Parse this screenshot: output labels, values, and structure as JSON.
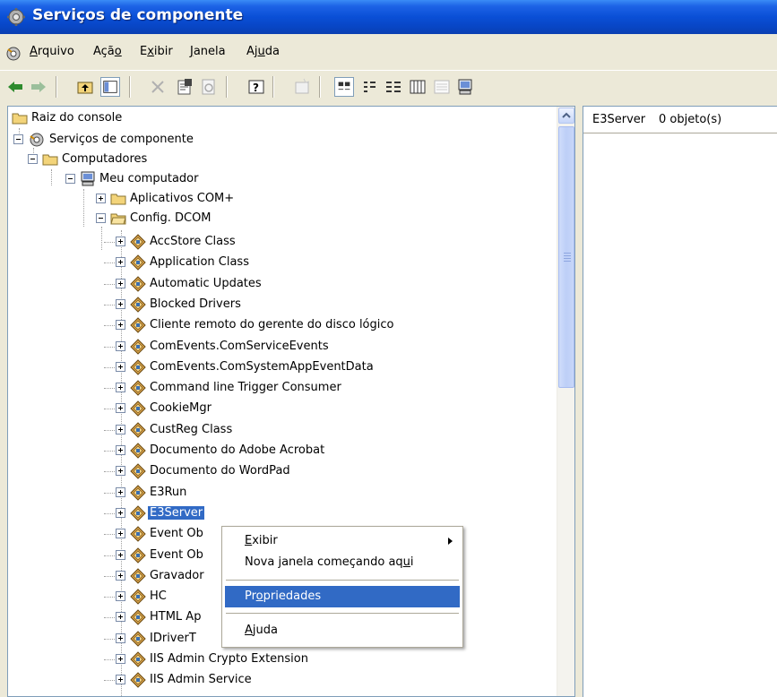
{
  "window": {
    "title": "Serviços de componente"
  },
  "menu": {
    "items": [
      {
        "pre": "",
        "mnem": "A",
        "post": "rquivo"
      },
      {
        "pre": "Açã",
        "mnem": "o",
        "post": ""
      },
      {
        "pre": "E",
        "mnem": "x",
        "post": "ibir"
      },
      {
        "pre": "",
        "mnem": "J",
        "post": "anela"
      },
      {
        "pre": "Aj",
        "mnem": "u",
        "post": "da"
      }
    ]
  },
  "toolbar": {
    "buttons": [
      "back-icon",
      "forward-icon",
      "up-folder-icon",
      "show-hide-tree-icon",
      "delete-icon",
      "properties-icon",
      "refresh-icon",
      "help-icon",
      "new-window-icon",
      "large-icons-icon",
      "small-icons-icon",
      "list-icon",
      "details-icon",
      "status-view-icon",
      "computer-icon"
    ]
  },
  "tree": {
    "root": "Raiz do console",
    "services": "Serviços de componente",
    "computers": "Computadores",
    "my_computer": "Meu computador",
    "com_apps": "Aplicativos COM+",
    "dcom": "Config. DCOM",
    "items": [
      "AccStore Class",
      "Application Class",
      "Automatic Updates",
      "Blocked Drivers",
      "Cliente remoto do gerente do disco lógico",
      "ComEvents.ComServiceEvents",
      "ComEvents.ComSystemAppEventData",
      "Command line Trigger Consumer",
      "CookieMgr",
      "CustReg Class",
      "Documento do Adobe Acrobat",
      "Documento do WordPad",
      "E3Run",
      "E3Server",
      "Event Ob",
      "Event Ob",
      "Gravador",
      "HC",
      "HTML Ap",
      "IDriverT",
      "IIS Admin Crypto Extension",
      "IIS Admin Service"
    ],
    "selected_index": 13
  },
  "list": {
    "col_name": "E3Server",
    "col_count": "0 objeto(s)"
  },
  "context_menu": {
    "exibir": {
      "pre": "",
      "mnem": "E",
      "post": "xibir"
    },
    "nova_janela": {
      "pre": "Nova janela começando aq",
      "mnem": "u",
      "post": "i"
    },
    "propriedades": {
      "pre": "Pr",
      "mnem": "o",
      "post": "priedades"
    },
    "ajuda": {
      "pre": "",
      "mnem": "A",
      "post": "juda"
    }
  },
  "colors": {
    "titlebar": "#0a4fd6",
    "selection": "#316ac5",
    "window_bg": "#ece9d8"
  }
}
